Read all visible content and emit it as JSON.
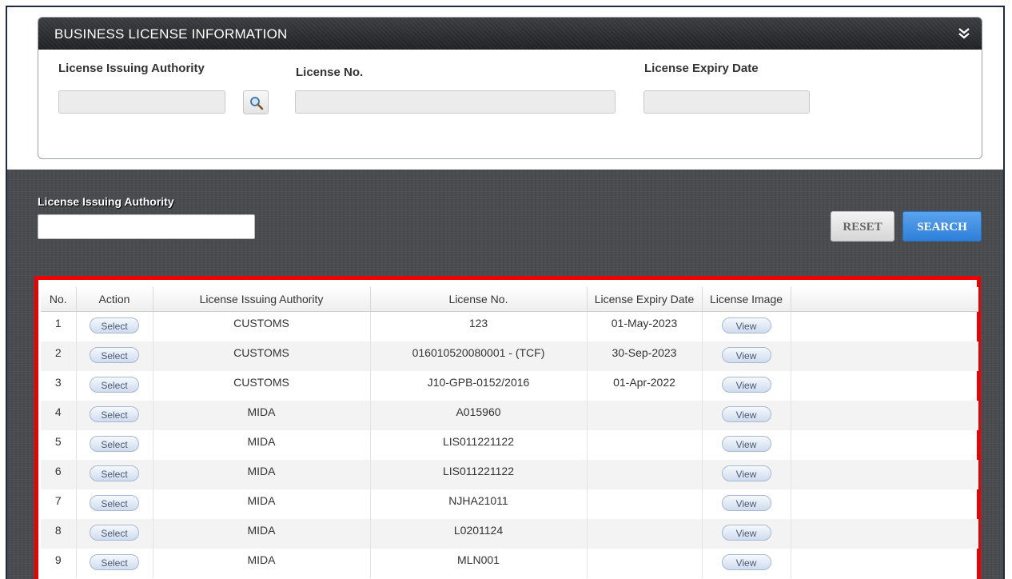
{
  "panel": {
    "title": "BUSINESS LICENSE INFORMATION",
    "collapse_icon": "double-chevron-down-icon",
    "fields": {
      "authority_label": "License Issuing Authority",
      "license_no_label": "License No.",
      "expiry_label": "License Expiry Date",
      "authority_value": "",
      "license_no_value": "",
      "expiry_value": ""
    },
    "lookup_icon": "magnifier-icon"
  },
  "search": {
    "authority_label": "License Issuing Authority",
    "authority_value": "",
    "reset_label": "RESET",
    "search_label": "SEARCH"
  },
  "table": {
    "columns": [
      "No.",
      "Action",
      "License Issuing Authority",
      "License No.",
      "License Expiry Date",
      "License Image",
      ""
    ],
    "select_label": "Select",
    "view_label": "View",
    "rows": [
      {
        "no": "1",
        "authority": "CUSTOMS",
        "license_no": "123",
        "expiry": "01-May-2023"
      },
      {
        "no": "2",
        "authority": "CUSTOMS",
        "license_no": "016010520080001 - (TCF)",
        "expiry": "30-Sep-2023"
      },
      {
        "no": "3",
        "authority": "CUSTOMS",
        "license_no": "J10-GPB-0152/2016",
        "expiry": "01-Apr-2022"
      },
      {
        "no": "4",
        "authority": "MIDA",
        "license_no": "A015960",
        "expiry": ""
      },
      {
        "no": "5",
        "authority": "MIDA",
        "license_no": "LIS011221122",
        "expiry": ""
      },
      {
        "no": "6",
        "authority": "MIDA",
        "license_no": "LIS011221122",
        "expiry": ""
      },
      {
        "no": "7",
        "authority": "MIDA",
        "license_no": "NJHA21011",
        "expiry": ""
      },
      {
        "no": "8",
        "authority": "MIDA",
        "license_no": "L0201124",
        "expiry": ""
      },
      {
        "no": "9",
        "authority": "MIDA",
        "license_no": "MLN001",
        "expiry": ""
      }
    ]
  },
  "colors": {
    "highlight_border": "#ee0000",
    "search_button": "#2f7fd9",
    "dark_background": "#4a4c50"
  }
}
